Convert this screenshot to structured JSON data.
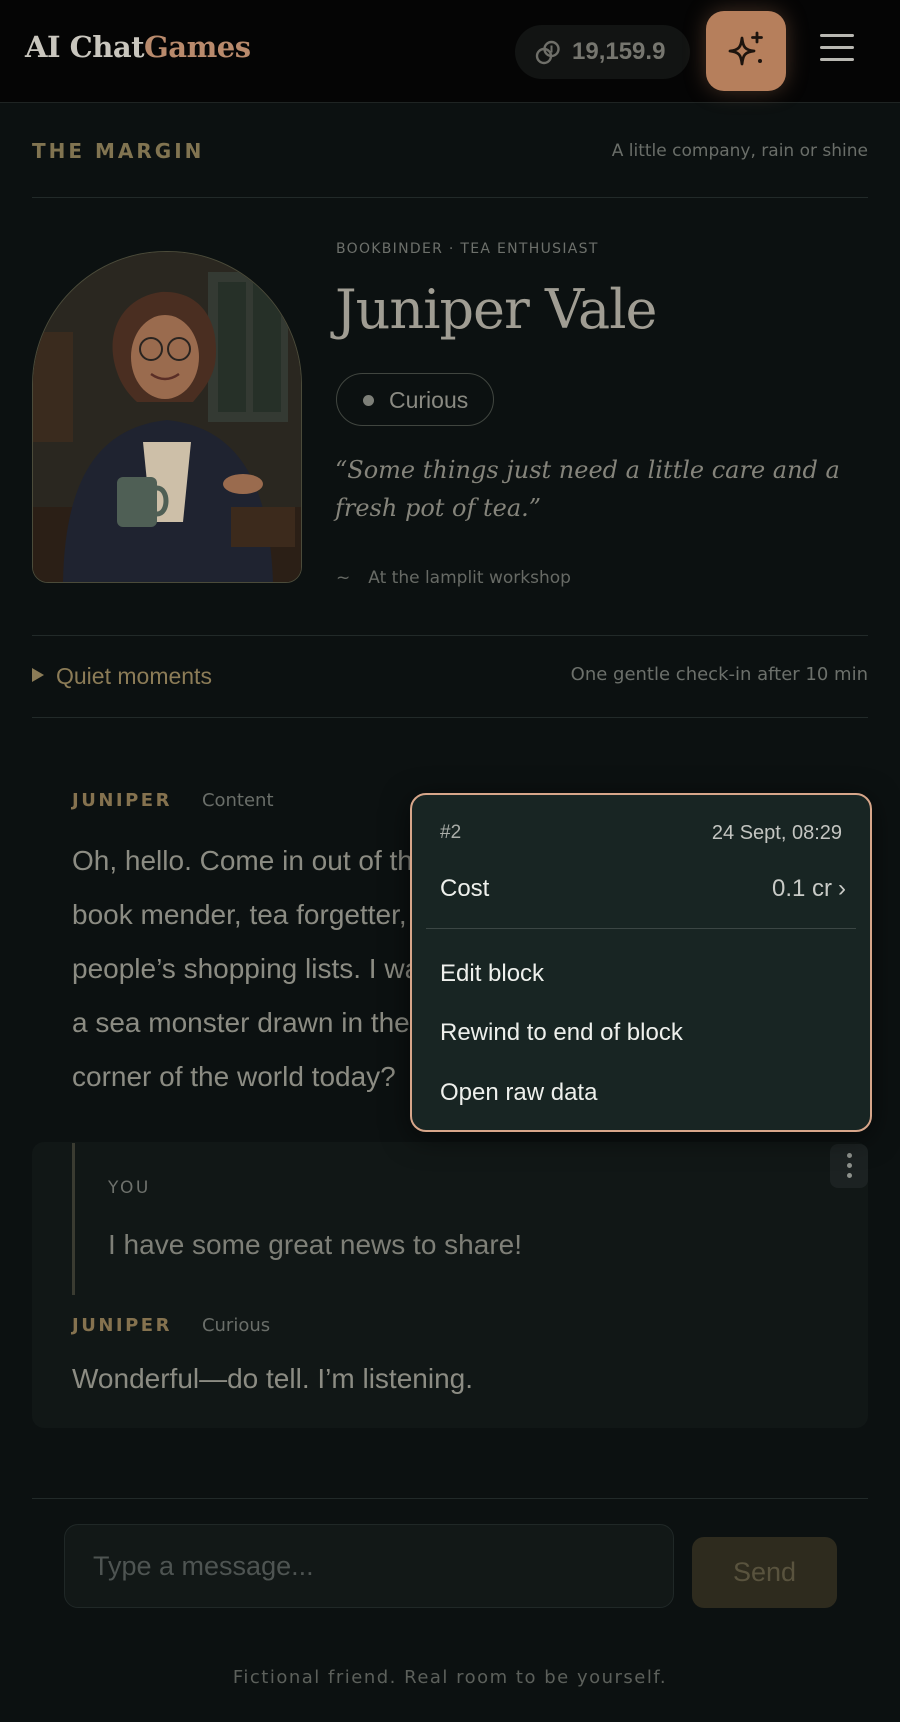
{
  "app": {
    "logo_main": "AI Chat",
    "logo_accent": "Games",
    "credits": "19,159.9",
    "accent_color": "#b67f5c"
  },
  "section": {
    "title": "THE MARGIN",
    "tagline": "A little company, rain or shine"
  },
  "character": {
    "eyebrow": "BOOKBINDER · TEA ENTHUSIAST",
    "name": "Juniper Vale",
    "mood": "Curious",
    "quote": "“Some things just need a little care and a fresh pot of tea.”",
    "location_icon": "~",
    "location": "At the lamplit workshop"
  },
  "quiet": {
    "label": "Quiet moments",
    "note": "One gentle check-in after 10 min"
  },
  "messages": {
    "m1": {
      "speaker": "JUNIPER",
      "emotion": "Content",
      "text": "Oh, hello. Come in out of the rain if you like. I’m Juniper — book mender, tea forgetter, occasional reader of other people’s shopping lists. I was just mending an old atlas with a sea monster drawn in the margin. What brings you to my corner of the world today?"
    },
    "you": {
      "label": "YOU",
      "text": "I have some great news to share!"
    },
    "m2": {
      "speaker": "JUNIPER",
      "emotion": "Curious",
      "text": "Wonderful—do tell. I’m listening."
    }
  },
  "popover": {
    "id": "#2",
    "date": "24 Sept, 08:29",
    "cost_label": "Cost",
    "cost_value": "0.1 cr",
    "items": [
      "Edit block",
      "Rewind to end of block",
      "Open raw data"
    ]
  },
  "composer": {
    "placeholder": "Type a message...",
    "send": "Send"
  },
  "footer": "Fictional friend. Real room to be yourself."
}
